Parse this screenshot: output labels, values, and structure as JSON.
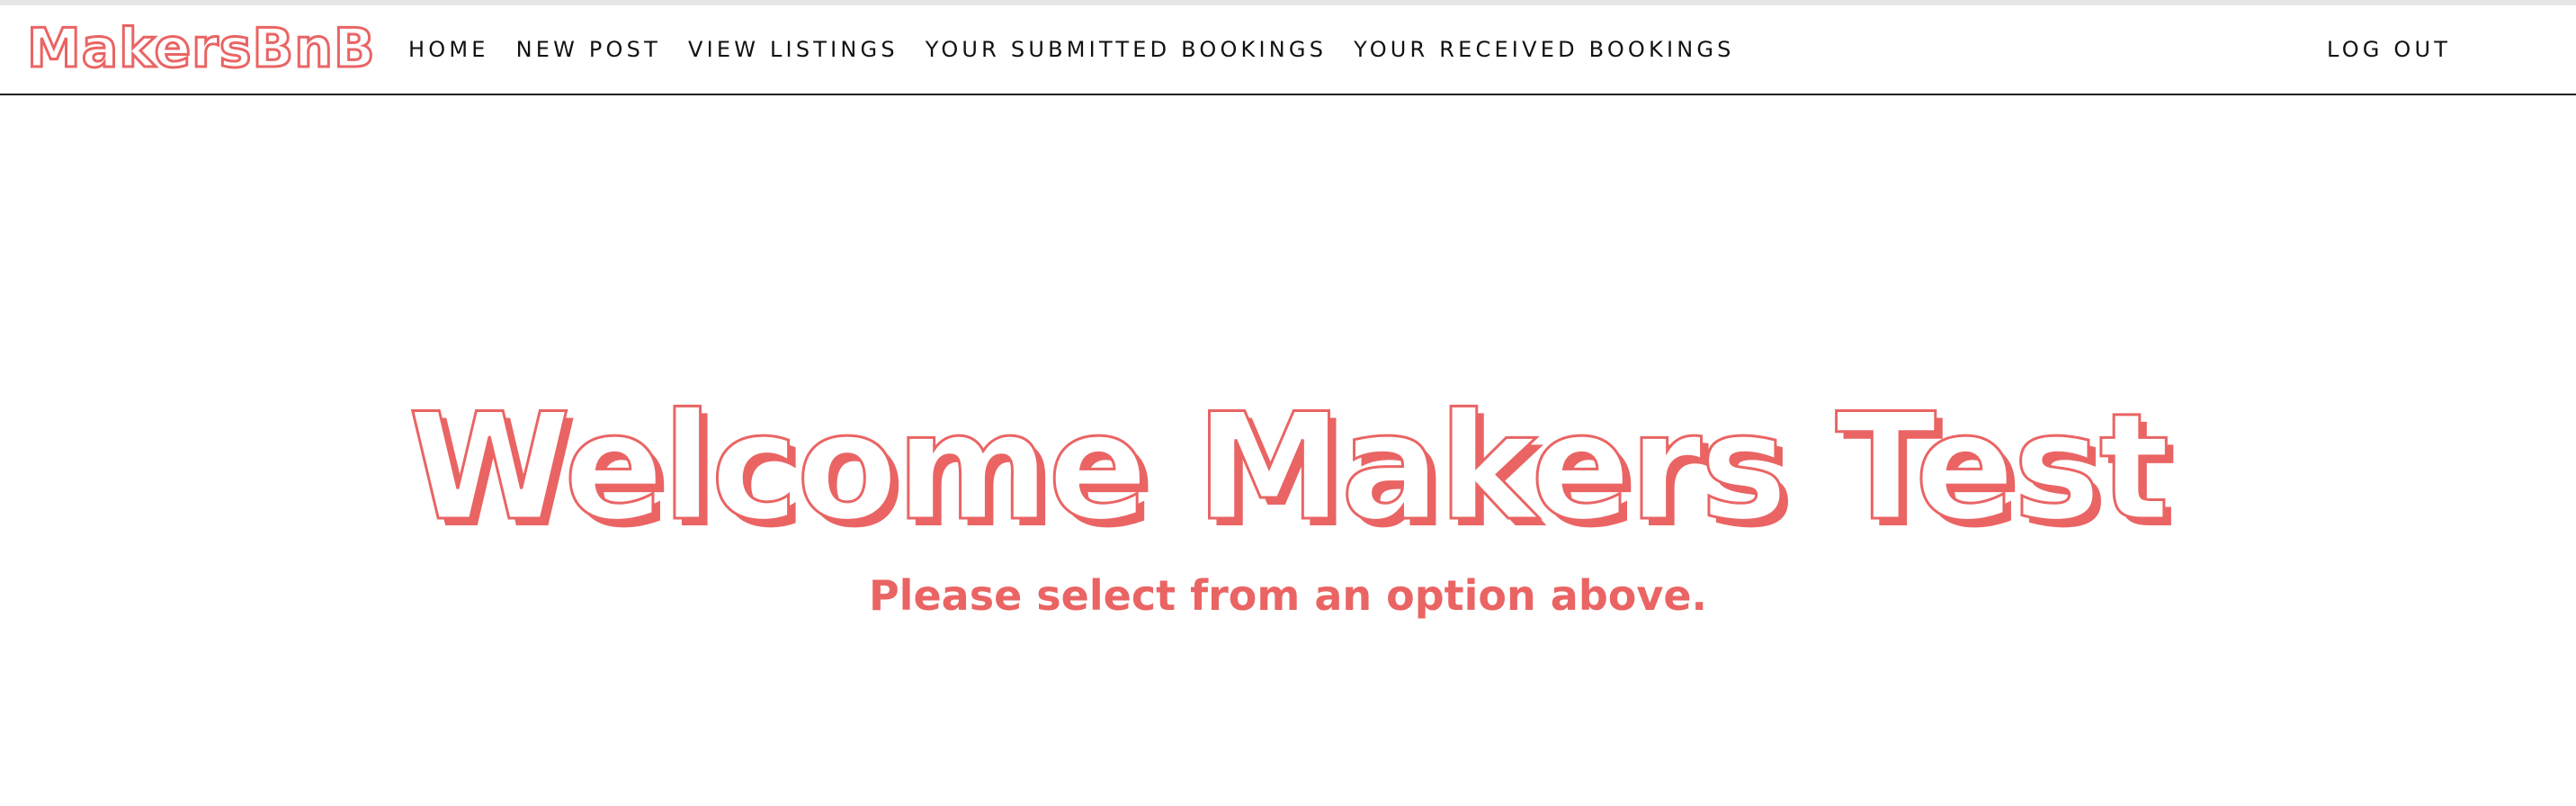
{
  "colors": {
    "accent": "#ea6464",
    "nav_text": "#111111",
    "background": "#ffffff",
    "navbar_border": "#222222"
  },
  "navbar": {
    "logo": "MakersBnB",
    "links": [
      {
        "label": "HOME"
      },
      {
        "label": "NEW POST"
      },
      {
        "label": "VIEW LISTINGS"
      },
      {
        "label": "YOUR SUBMITTED BOOKINGS"
      },
      {
        "label": "YOUR RECEIVED BOOKINGS"
      }
    ],
    "logout": "LOG OUT"
  },
  "main": {
    "title": "Welcome Makers Test",
    "subtitle": "Please select from an option above."
  }
}
